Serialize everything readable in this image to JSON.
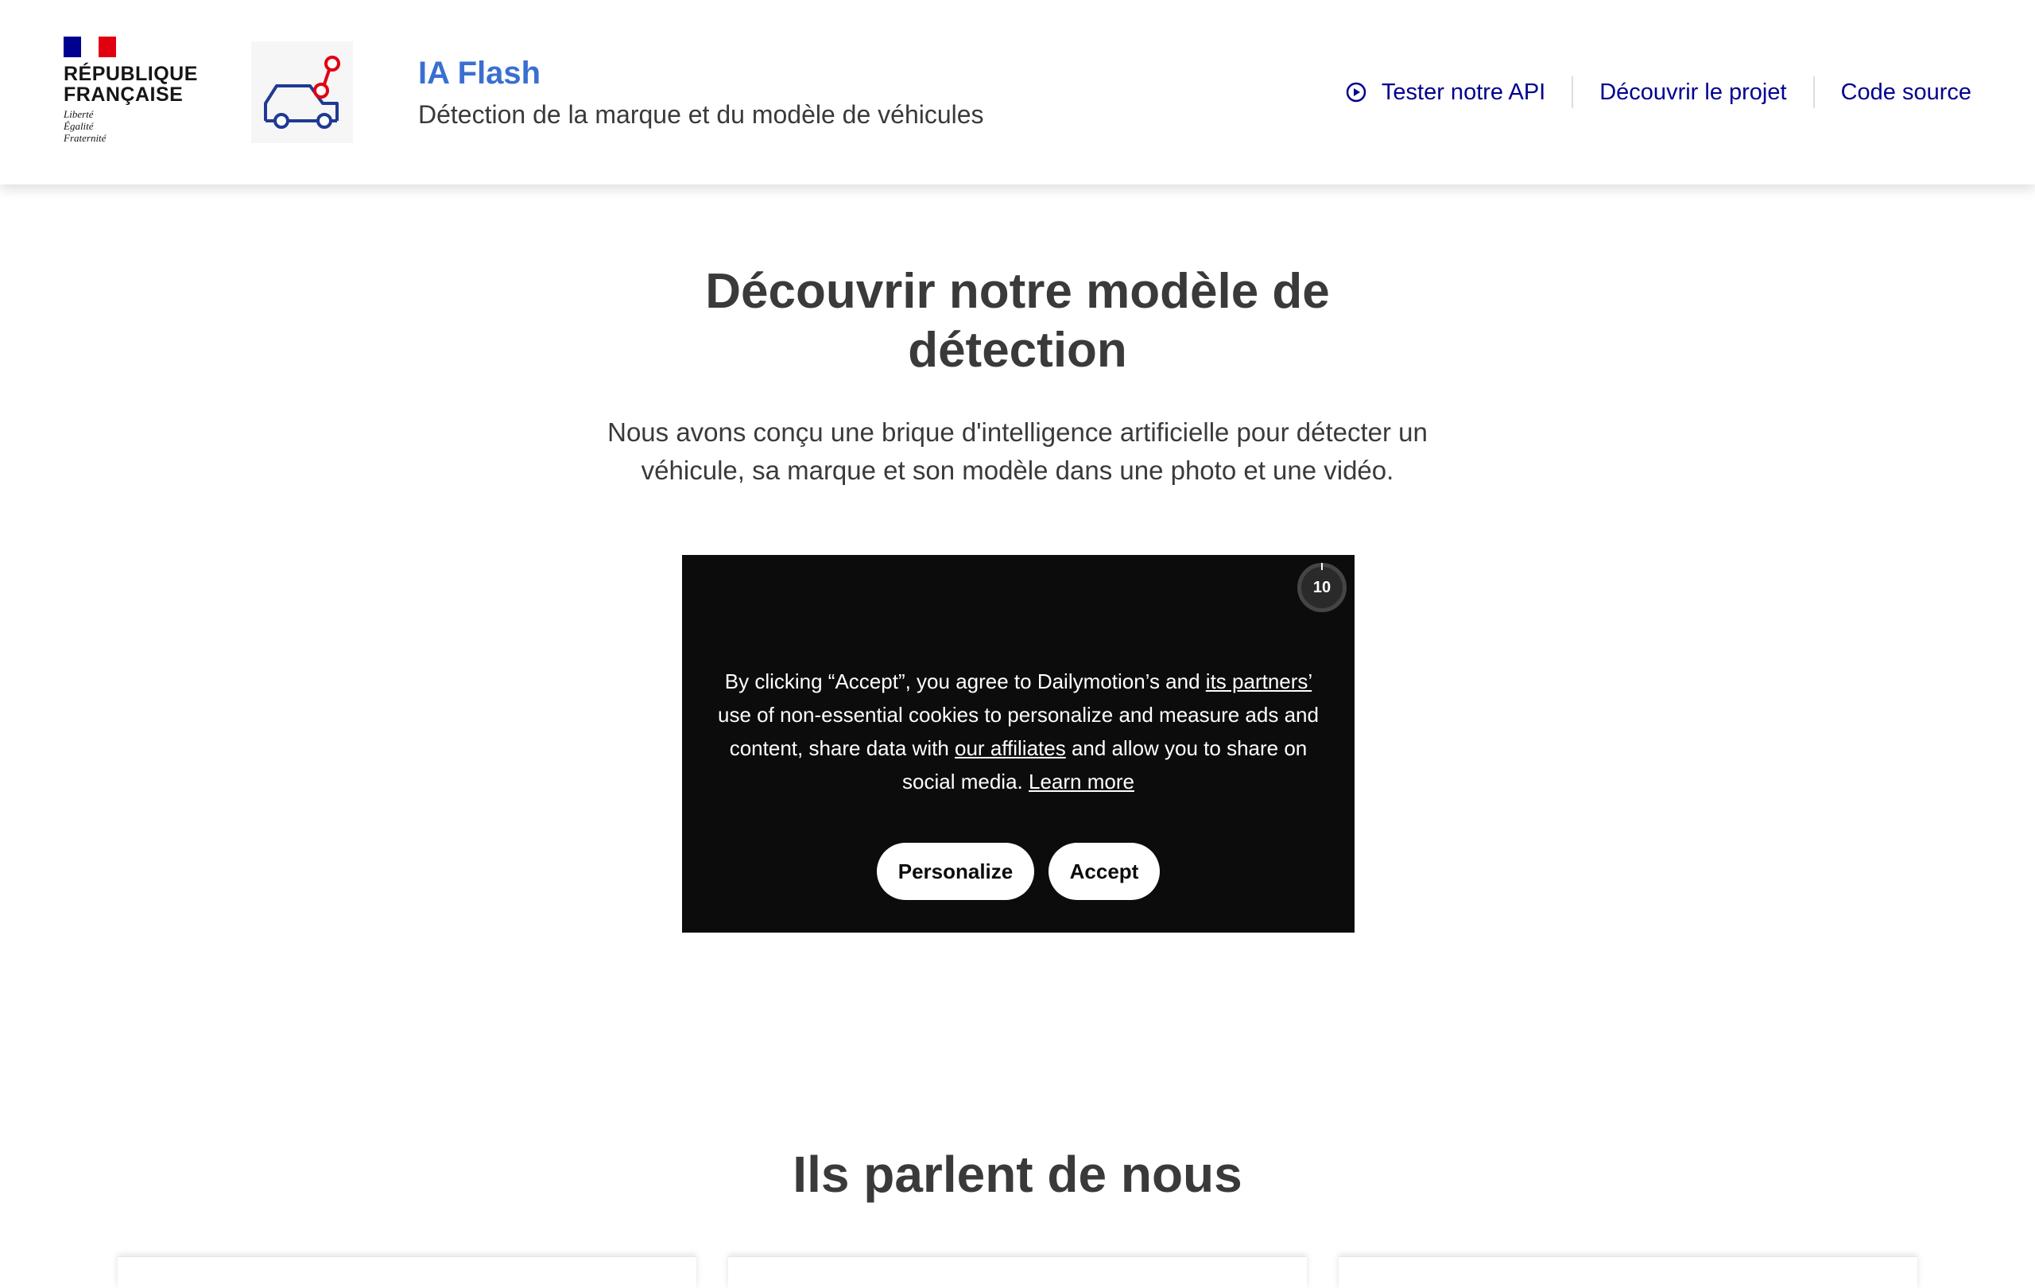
{
  "header": {
    "gov": {
      "name_line1": "RÉPUBLIQUE",
      "name_line2": "FRANÇAISE",
      "motto": [
        "Liberté",
        "Égalité",
        "Fraternité"
      ],
      "colors": {
        "blue": "#000091",
        "red": "#e1000f"
      }
    },
    "app_logo_icon": "car-detection-icon",
    "title": "IA Flash",
    "subtitle": "Détection de la marque et du modèle de véhicules",
    "nav": [
      {
        "label": "Tester notre API",
        "icon": "play-circle-icon"
      },
      {
        "label": "Découvrir le projet"
      },
      {
        "label": "Code source"
      }
    ]
  },
  "hero": {
    "title_lines": [
      "Découvrir notre modèle de",
      "détection"
    ],
    "description_lines": [
      "Nous avons conçu une brique d'intelligence artificielle pour détecter un",
      "véhicule, sa marque et son modèle dans une photo et une vidéo."
    ]
  },
  "video": {
    "countdown": "10",
    "consent": {
      "text_1": "By clicking “Accept”, you agree to Dailymotion’s and ",
      "link_partners": "its partners’",
      "text_2": " use of non-essential cookies to personalize and measure ads and content, share data with ",
      "link_affiliates": "our affiliates",
      "text_3": " and allow you to share on social media. ",
      "link_learn_more": "Learn more"
    },
    "buttons": {
      "personalize": "Personalize",
      "accept": "Accept"
    }
  },
  "press": {
    "title": "Ils parlent de nous"
  },
  "colors": {
    "accent": "#000091",
    "title_blue": "#3a6fd1",
    "text": "#3a3a3a",
    "video_bg": "#0c0c0c"
  }
}
